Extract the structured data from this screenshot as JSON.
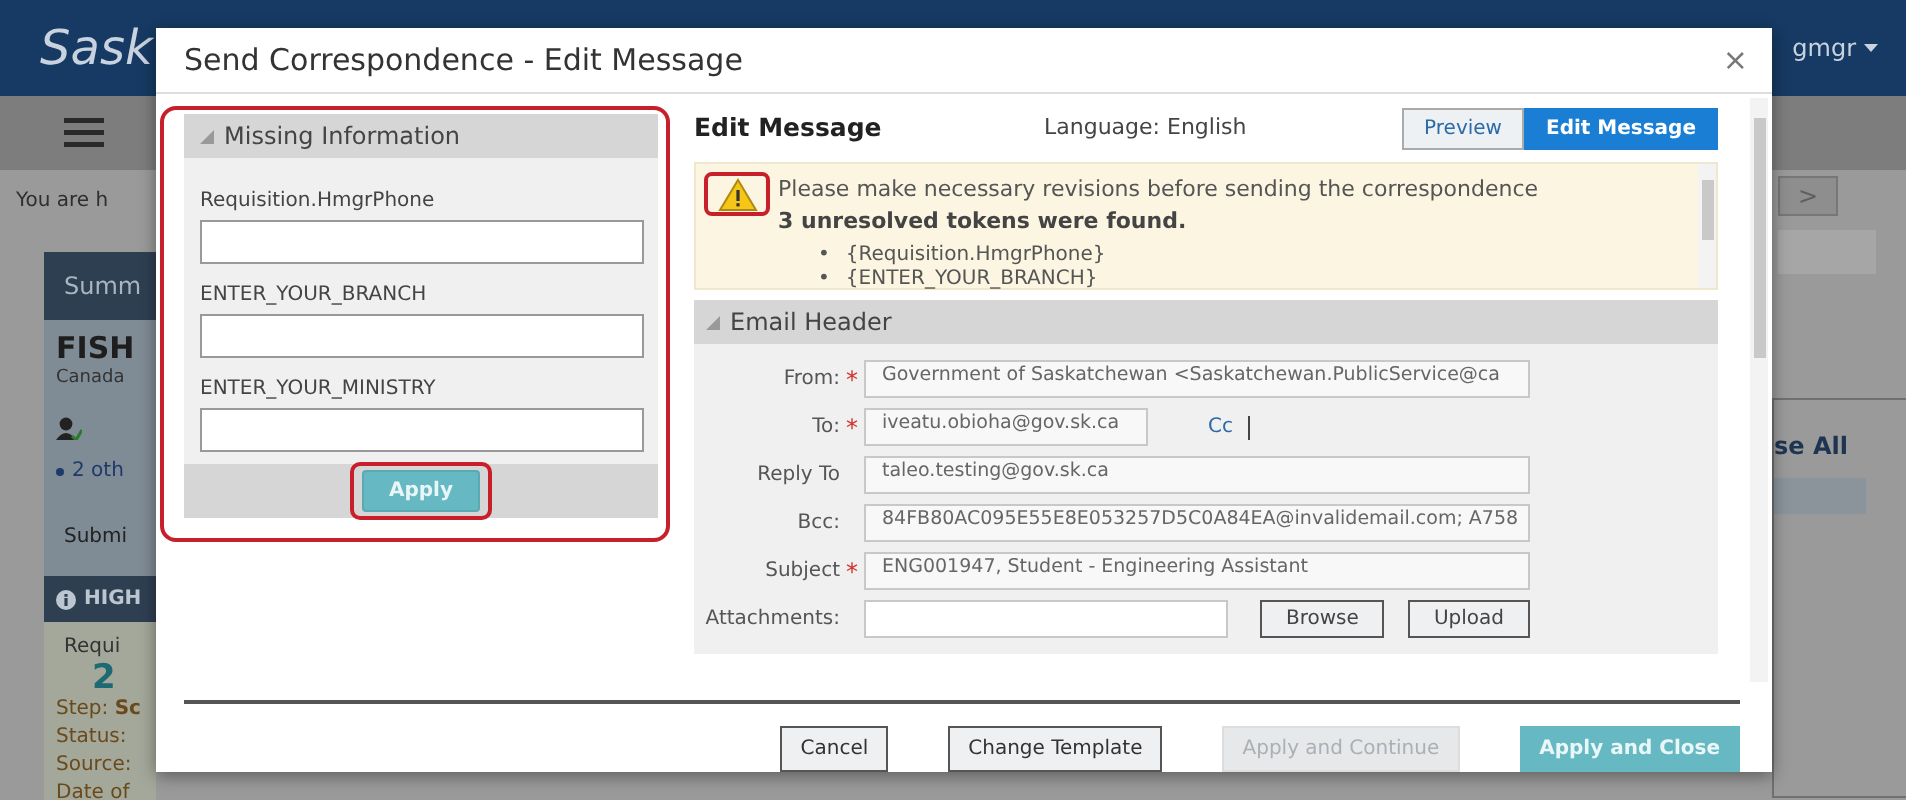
{
  "background_page": {
    "brand": "Sask",
    "user": "gmgr",
    "breadcrumb": "You are h",
    "summary_title": "Summ",
    "job_title": "FISH",
    "job_location": "Canada",
    "others_link": "2 oth",
    "submitted": "Submi",
    "highlights_title": "HIGH",
    "requisition_label": "Requi",
    "requisition_count": "2",
    "details": [
      "Step: **Sc**",
      "Status:",
      "Source:",
      "Date of"
    ],
    "next_button": ">",
    "collapse_link": "se All"
  },
  "modal": {
    "title": "Send Correspondence - Edit Message",
    "close": "×"
  },
  "missing_information": {
    "title": "Missing Information",
    "fields": [
      {
        "label": "Requisition.HmgrPhone"
      },
      {
        "label": "ENTER_YOUR_BRANCH"
      },
      {
        "label": "ENTER_YOUR_MINISTRY"
      }
    ],
    "apply_button": "Apply"
  },
  "edit_message": {
    "title": "Edit Message",
    "language": "Language: English",
    "view_toggle": [
      {
        "label": "Preview",
        "selected": false
      },
      {
        "label": "Edit Message",
        "selected": true
      }
    ],
    "warning": {
      "message": "Please make necessary revisions before sending the correspondence",
      "count_text": "3 unresolved tokens were found.",
      "tokens": [
        {
          "bullet": "•",
          "text": "{Requisition.HmgrPhone}"
        },
        {
          "bullet": "•",
          "text": "{ENTER_YOUR_BRANCH}"
        }
      ]
    },
    "email_header": {
      "title": "Email Header",
      "fields": [
        {
          "kind": "text",
          "label": "From:",
          "required_mark": "*",
          "value": "Government of Saskatchewan <Saskatchewan.PublicService@ca"
        },
        {
          "kind": "recipients",
          "label": "To:",
          "required_mark": "*",
          "value": "iveatu.obioha@gov.sk.ca",
          "cc_link": "Cc"
        },
        {
          "kind": "text",
          "label": "Reply To",
          "value": "taleo.testing@gov.sk.ca"
        },
        {
          "kind": "text",
          "label": "Bcc:",
          "value": "84FB80AC095E55E8E053257D5C0A84EA@invalidemail.com; A758"
        },
        {
          "kind": "text",
          "label": "Subject",
          "required_mark": "*",
          "value": "ENG001947, Student - Engineering Assistant"
        },
        {
          "kind": "attachment",
          "label": "Attachments:",
          "browse": "Browse",
          "upload": "Upload"
        }
      ]
    }
  },
  "footer_buttons": [
    {
      "label": "Cancel",
      "kind": "default",
      "disabled": false
    },
    {
      "label": "Change Template",
      "kind": "default",
      "disabled": false
    },
    {
      "label": "Apply and Continue",
      "kind": "default",
      "disabled": true
    },
    {
      "label": "Apply and Close",
      "kind": "primary",
      "disabled": false
    }
  ]
}
